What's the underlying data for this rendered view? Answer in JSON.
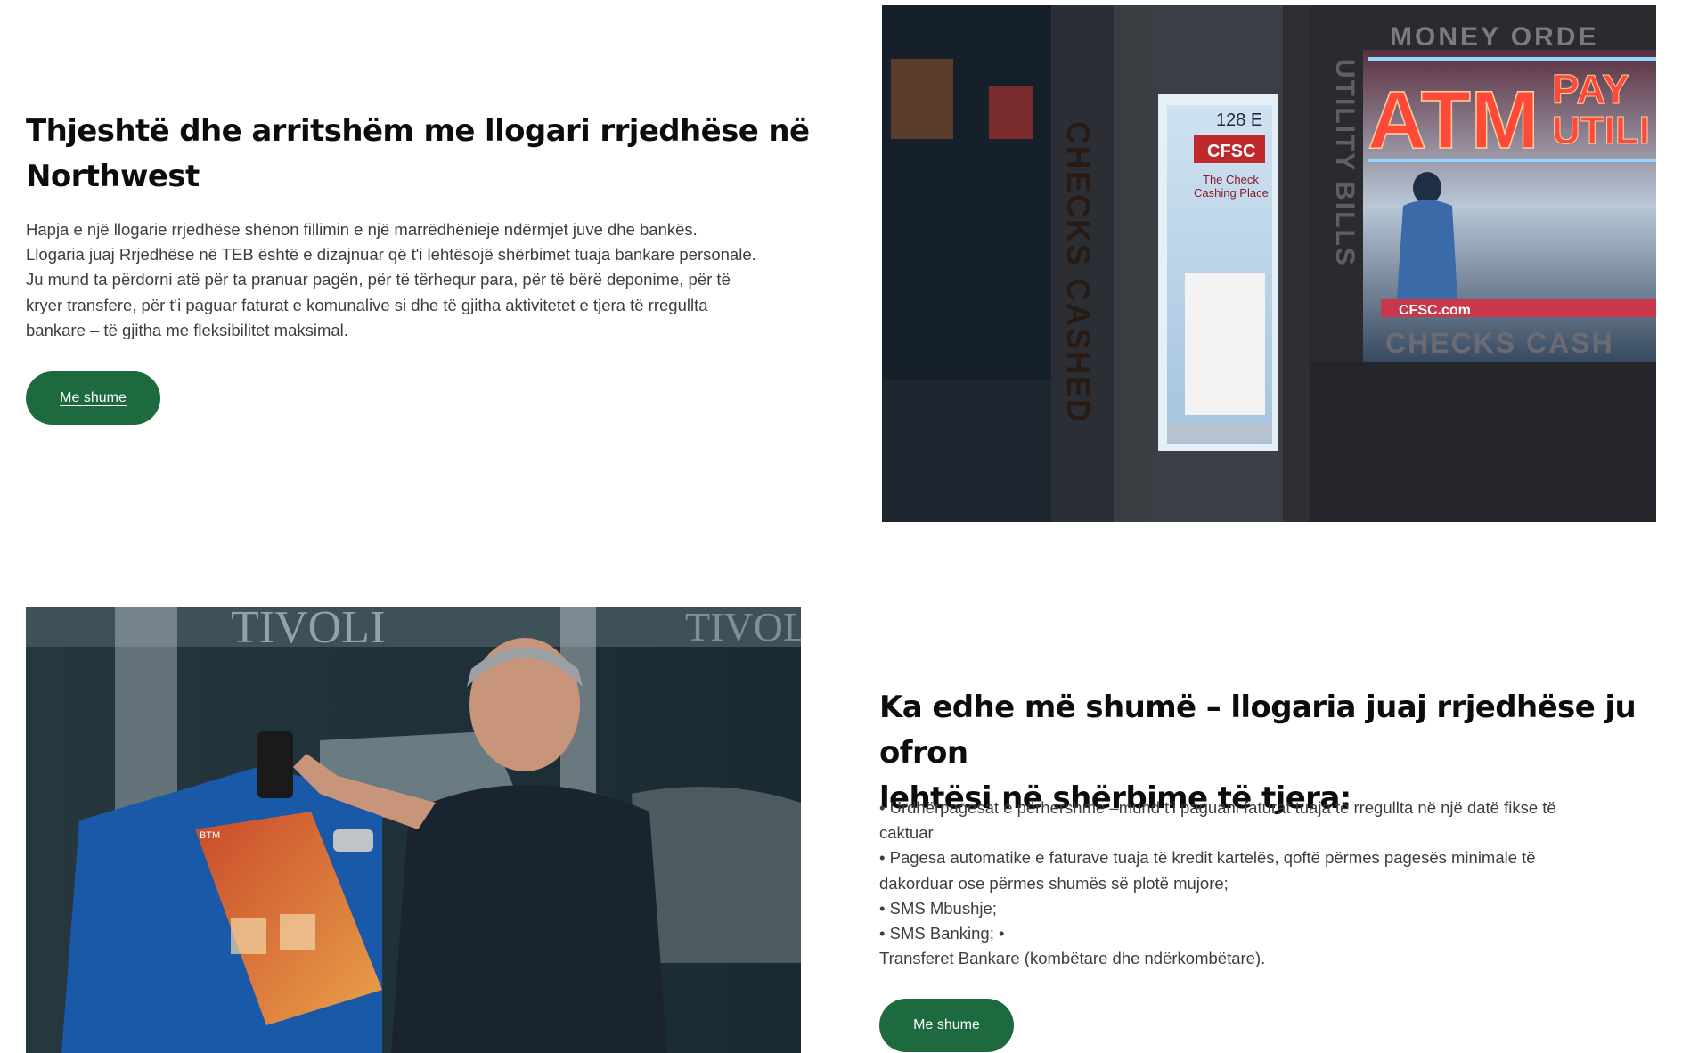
{
  "section1": {
    "title_line1": "Thjeshtë dhe arritshëm me llogari rrjedhëse në",
    "title_line2": "Northwest",
    "paragraph_lines": [
      "Hapja e një llogarie rrjedhëse shënon fillimin e një marrëdhënieje ndërmjet juve dhe bankës.",
      "Llogaria juaj Rrjedhëse në TEB është e dizajnuar që t'i lehtësojë shërbimet tuaja bankare personale.",
      "Ju mund ta përdorni atë për ta pranuar pagën, për të tërhequr para, për të bërë deponime, për të",
      "kryer transfere, për t'i paguar faturat e komunalive si dhe të gjitha aktivitetet e tjera të rregullta",
      "bankare – të gjitha me fleksibilitet maksimal."
    ],
    "button_label": "Me shume"
  },
  "photo1": {
    "sign_money_order": "MONEY ORDE",
    "sign_atm": "ATM",
    "sign_pay": "PAY",
    "sign_util": "UTILI",
    "door_number": "128 E",
    "door_brand": "CFSC",
    "door_text1": "The Check",
    "door_text2": "Cashing Place",
    "vertical_left": "CHECKS CASHED",
    "vertical_right": "UTILITY BILLS",
    "lower_sign": "CHECKS CASH",
    "window_brand": "CFSC.com"
  },
  "photo2": {
    "building_text": "TIVOLI",
    "building_text2": "TIVOLI",
    "kiosk_label": "BTM"
  },
  "section2": {
    "title_line1": "Ka edhe më shumë – llogaria juaj rrjedhëse ju ofron",
    "title_line2": "lehtësi në shërbime të tjera:",
    "paragraph_lines": [
      "• Urdhërpagesat e përhershme –mund t'i paguani faturat tuaja të rregullta në një datë fikse të",
      "caktuar",
      "• Pagesa automatike e faturave tuaja të kredit kartelës, qoftë përmes pagesës minimale të",
      "dakorduar ose përmes shumës së plotë mujore;",
      "• SMS Mbushje;",
      "• SMS Banking; •",
      "Transferet Bankare (kombëtare dhe ndërkombëtare)."
    ],
    "button_label": "Me shume"
  },
  "colors": {
    "button_bg": "#1d6a3f",
    "title": "#0c0c0c",
    "body_text": "#3d3d3d"
  }
}
